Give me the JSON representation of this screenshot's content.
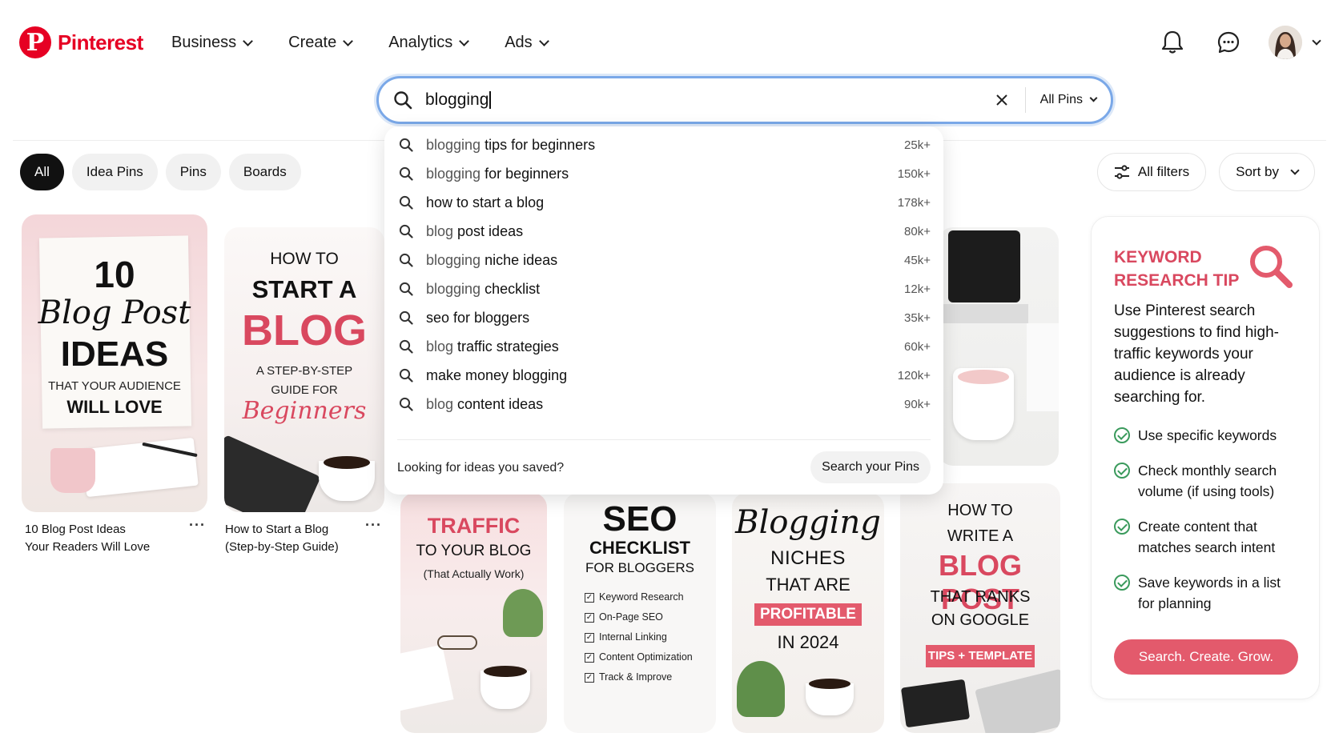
{
  "header": {
    "logo_text": "Pinterest",
    "nav": [
      {
        "label": "Business"
      },
      {
        "label": "Create"
      },
      {
        "label": "Analytics"
      },
      {
        "label": "Ads"
      }
    ],
    "icons": [
      "bell-icon",
      "message-icon",
      "avatar",
      "chevron-down-icon"
    ]
  },
  "search": {
    "value": "blogging",
    "scope_label": "All Pins"
  },
  "filters": {
    "chips": [
      {
        "label": "All",
        "active": true
      },
      {
        "label": "Idea Pins",
        "active": false
      },
      {
        "label": "Pins",
        "active": false
      },
      {
        "label": "Boards",
        "active": false
      }
    ],
    "all_filters_label": "All filters",
    "sort_label": "Sort by"
  },
  "suggestions": [
    {
      "query": "blogging",
      "rest": " tips for beginners",
      "count": "25k+"
    },
    {
      "query": "blogging",
      "rest": " for beginners",
      "count": "150k+"
    },
    {
      "query": "",
      "rest": "how to start a blog",
      "count": "178k+"
    },
    {
      "query": "blog",
      "rest": " post ideas",
      "count": "80k+"
    },
    {
      "query": "blogging",
      "rest": " niche ideas",
      "count": "45k+"
    },
    {
      "query": "blogging",
      "rest": " checklist",
      "count": "12k+"
    },
    {
      "query": "",
      "rest": "seo for bloggers",
      "count": "35k+"
    },
    {
      "query": "blog",
      "rest": " traffic strategies",
      "count": "60k+"
    },
    {
      "query": "",
      "rest": "make money blogging",
      "count": "120k+"
    },
    {
      "query": "blog",
      "rest": " content ideas",
      "count": "90k+"
    }
  ],
  "dropdown_footer": {
    "text": "Looking for ideas you saved?",
    "button": "Search your Pins"
  },
  "pins": {
    "p1": {
      "line1": "10",
      "line2": "Blog Post",
      "line3": "IDEAS",
      "line4": "THAT YOUR AUDIENCE",
      "line5": "WILL LOVE",
      "caption1": "10 Blog Post Ideas",
      "caption2": "Your Readers Will Love"
    },
    "p2": {
      "line1": "HOW TO",
      "line2": "START A",
      "line3": "BLOG",
      "line4a": "A STEP-BY-STEP",
      "line4b": "GUIDE FOR",
      "line5": "Beginners",
      "caption1": "How to Start a Blog",
      "caption2": "(Step-by-Step Guide)"
    },
    "p5": {
      "line1": "TRAFFIC",
      "line2": "TO YOUR BLOG",
      "line3": "(That Actually Work)"
    },
    "p6": {
      "line1": "SEO",
      "line2": "CHECKLIST",
      "line3": "FOR BLOGGERS",
      "items": [
        "Keyword Research",
        "On-Page SEO",
        "Internal Linking",
        "Content Optimization",
        "Track & Improve"
      ]
    },
    "p7": {
      "line1": "Blogging",
      "line2": "NICHES",
      "line3": "THAT ARE",
      "line4": "PROFITABLE",
      "line5": "IN 2024"
    },
    "p8": {
      "line1a": "HOW TO",
      "line1b": "WRITE A",
      "line2": "BLOG POST",
      "line3a": "THAT RANKS",
      "line3b": "ON GOOGLE",
      "line4": "TIPS + TEMPLATE"
    }
  },
  "tip": {
    "title": "KEYWORD RESEARCH TIP",
    "body": "Use Pinterest search suggestions to find high-traffic keywords your audience is already searching for.",
    "items": [
      "Use specific keywords",
      "Check monthly search volume (if using tools)",
      "Create content that matches search intent",
      "Save keywords in a list for planning"
    ],
    "button": "Search. Create. Grow."
  },
  "colors": {
    "brand": "#e60023",
    "accent": "#d9485f",
    "check": "#3a9a5c",
    "focus": "#7aa8e8"
  }
}
